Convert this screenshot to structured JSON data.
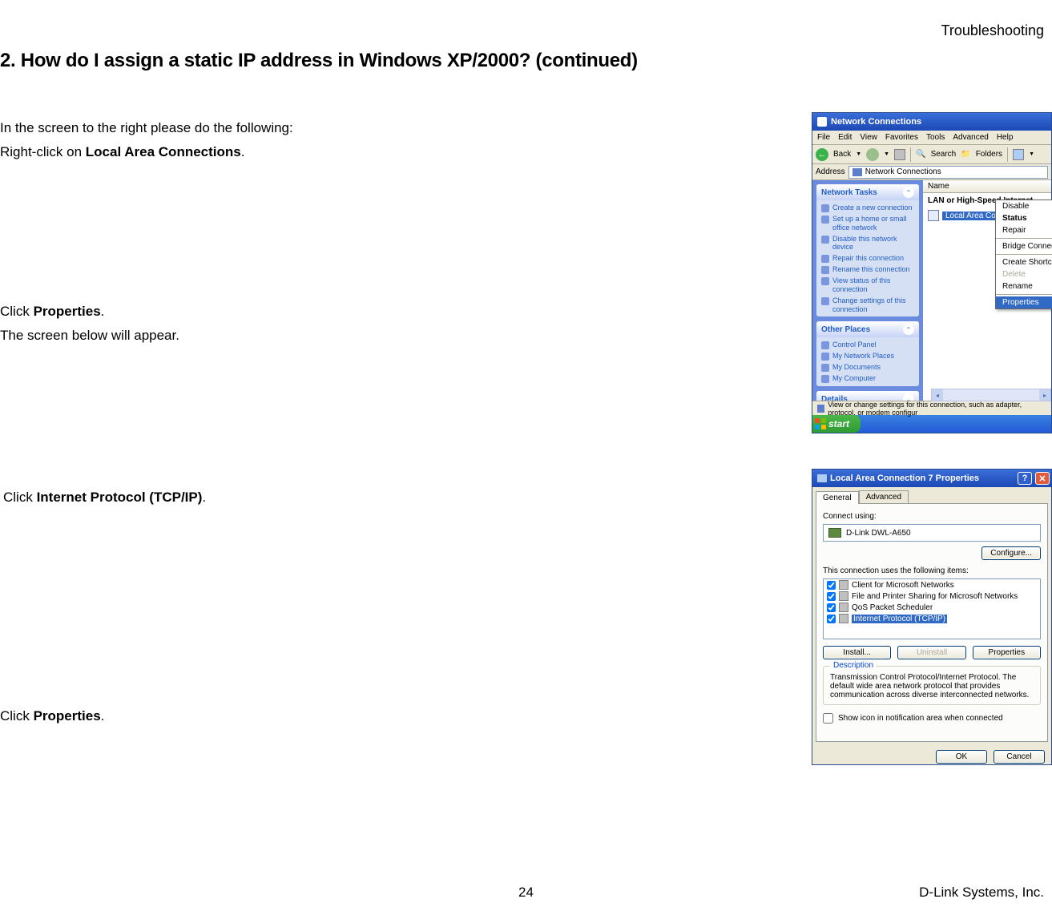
{
  "header": {
    "section": "Troubleshooting"
  },
  "title": "2. How do I assign a static IP address in Windows XP/2000? (continued)",
  "instructions": {
    "line1": "In the screen to the right please do the following:",
    "line2_pre": "Right-click on ",
    "line2_bold": "Local Area Connections",
    "line2_post": ".",
    "line3_pre": "Click ",
    "line3_bold": "Properties",
    "line3_post": ".",
    "line4": "The screen below will appear.",
    "line5_pre": "Click ",
    "line5_bold": "Internet Protocol  (TCP/IP)",
    "line5_post": ".",
    "line6_pre": "Click ",
    "line6_bold": "Properties",
    "line6_post": "."
  },
  "footer": {
    "page": "24",
    "company": "D-Link Systems, Inc."
  },
  "ss1": {
    "title": "Network Connections",
    "menus": {
      "file": "File",
      "edit": "Edit",
      "view": "View",
      "favorites": "Favorites",
      "tools": "Tools",
      "advanced": "Advanced",
      "help": "Help"
    },
    "toolbar": {
      "back": "Back",
      "search": "Search",
      "folders": "Folders"
    },
    "address_label": "Address",
    "address_value": "Network Connections",
    "col_name": "Name",
    "group": "LAN or High-Speed Internet",
    "connection": "Local Area Con",
    "panel1": {
      "title": "Network Tasks",
      "items": {
        "a": "Create a new connection",
        "b": "Set up a home or small office network",
        "c": "Disable this network device",
        "d": "Repair this connection",
        "e": "Rename this connection",
        "f": "View status of this connection",
        "g": "Change settings of this connection"
      }
    },
    "panel2": {
      "title": "Other Places",
      "items": {
        "a": "Control Panel",
        "b": "My Network Places",
        "c": "My Documents",
        "d": "My Computer"
      }
    },
    "panel3": {
      "title": "Details"
    },
    "context": {
      "disable": "Disable",
      "status": "Status",
      "repair": "Repair",
      "bridge": "Bridge Connections",
      "shortcut": "Create Shortcut",
      "delete": "Delete",
      "rename": "Rename",
      "properties": "Properties"
    },
    "status": "View or change settings for this connection, such as adapter, protocol, or modem configur",
    "start": "start"
  },
  "ss2": {
    "title": "Local Area Connection 7 Properties",
    "help": "?",
    "close": "✕",
    "tabs": {
      "general": "General",
      "advanced": "Advanced"
    },
    "connect_using": "Connect using:",
    "adapter": "D-Link DWL-A650",
    "configure": "Configure...",
    "uses_items": "This connection uses the following items:",
    "items": {
      "a": "Client for Microsoft Networks",
      "b": "File and Printer Sharing for Microsoft Networks",
      "c": "QoS Packet Scheduler",
      "d": "Internet Protocol (TCP/IP)"
    },
    "install": "Install...",
    "uninstall": "Uninstall",
    "properties": "Properties",
    "desc_label": "Description",
    "desc_text": "Transmission Control Protocol/Internet Protocol. The default wide area network protocol that provides communication across diverse interconnected networks.",
    "show_icon": "Show icon in notification area when connected",
    "ok": "OK",
    "cancel": "Cancel"
  }
}
